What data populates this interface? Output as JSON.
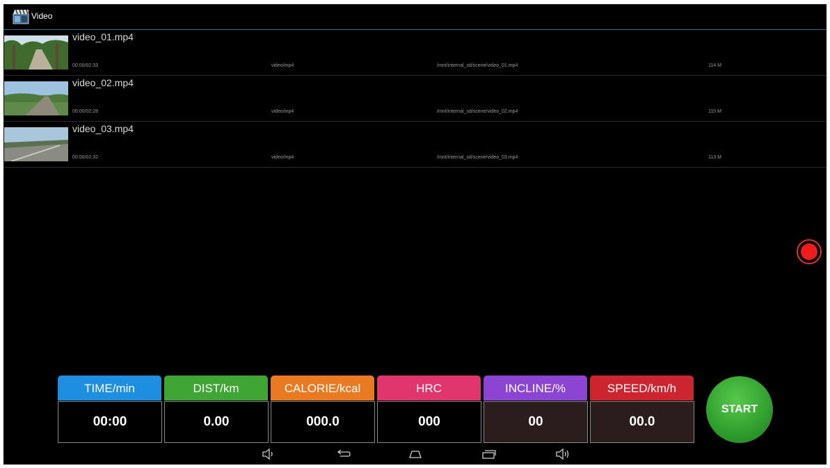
{
  "app": {
    "title": "Video",
    "icon": "clapperboard-icon"
  },
  "videos": [
    {
      "name": "video_01.mp4",
      "duration": "00:00/02:33",
      "type": "video/mp4",
      "path": "/mnt/internal_sd/scene/video_01.mp4",
      "size": "114 M"
    },
    {
      "name": "video_02.mp4",
      "duration": "00:00/02:28",
      "type": "video/mp4",
      "path": "/mnt/internal_sd/scene/video_02.mp4",
      "size": "110 M"
    },
    {
      "name": "video_03.mp4",
      "duration": "00:00/02:32",
      "type": "video/mp4",
      "path": "/mnt/internal_sd/scene/video_03.mp4",
      "size": "113 M"
    }
  ],
  "stats": [
    {
      "label": "TIME/min",
      "value": "00:00",
      "color": "#1e8fe0",
      "bg": "#000000"
    },
    {
      "label": "DIST/km",
      "value": "0.00",
      "color": "#3fa535",
      "bg": "#000000"
    },
    {
      "label": "CALORIE/kcal",
      "value": "000.0",
      "color": "#ea7a22",
      "bg": "#000000"
    },
    {
      "label": "HRC",
      "value": "000",
      "color": "#e0356d",
      "bg": "#000000"
    },
    {
      "label": "INCLINE/%",
      "value": "00",
      "color": "#8c45d2",
      "bg": "#2b1d1d"
    },
    {
      "label": "SPEED/km/h",
      "value": "00.0",
      "color": "#cc2530",
      "bg": "#2b1d1d"
    }
  ],
  "start_button": "START",
  "navbar": [
    "volume-down-icon",
    "back-icon",
    "home-icon",
    "recent-apps-icon",
    "volume-up-icon"
  ]
}
